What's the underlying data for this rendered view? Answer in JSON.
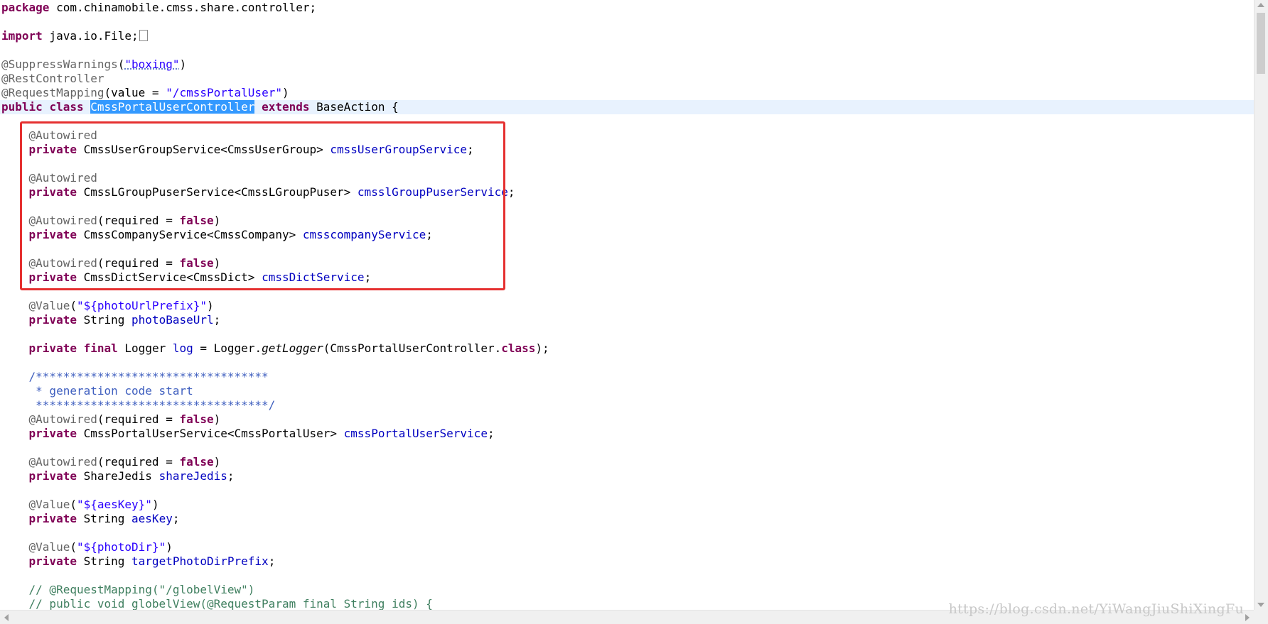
{
  "editor": {
    "lines": [
      [
        {
          "t": "package",
          "c": "kw"
        },
        {
          "t": " com.chinamobile.cmss.share.controller;"
        }
      ],
      [],
      [
        {
          "t": "import",
          "c": "kw"
        },
        {
          "t": " java.io.File;"
        },
        {
          "fold": true
        }
      ],
      [],
      [
        {
          "t": "@SuppressWarnings",
          "c": "ann"
        },
        {
          "t": "("
        },
        {
          "t": "\"boxing\"",
          "c": "str squig"
        },
        {
          "t": ")"
        }
      ],
      [
        {
          "t": "@RestController",
          "c": "ann"
        }
      ],
      [
        {
          "t": "@RequestMapping",
          "c": "ann"
        },
        {
          "t": "(value = "
        },
        {
          "t": "\"/cmssPortalUser\"",
          "c": "str"
        },
        {
          "t": ")"
        }
      ],
      [
        {
          "t": "public",
          "c": "kw"
        },
        {
          "t": " "
        },
        {
          "t": "class",
          "c": "kw"
        },
        {
          "t": " "
        },
        {
          "t": "CmssPortalUserController",
          "c": "sel"
        },
        {
          "t": " "
        },
        {
          "t": "extends",
          "c": "kw"
        },
        {
          "t": " BaseAction {"
        }
      ],
      [],
      [
        {
          "t": "    "
        },
        {
          "t": "@Autowired",
          "c": "ann"
        }
      ],
      [
        {
          "t": "    "
        },
        {
          "t": "private",
          "c": "kw"
        },
        {
          "t": " CmssUserGroupService<CmssUserGroup> "
        },
        {
          "t": "cmssUserGroupService",
          "c": "field"
        },
        {
          "t": ";"
        }
      ],
      [],
      [
        {
          "t": "    "
        },
        {
          "t": "@Autowired",
          "c": "ann"
        }
      ],
      [
        {
          "t": "    "
        },
        {
          "t": "private",
          "c": "kw"
        },
        {
          "t": " CmssLGroupPuserService<CmssLGroupPuser> "
        },
        {
          "t": "cmsslGroupPuserService",
          "c": "field"
        },
        {
          "t": ";"
        }
      ],
      [],
      [
        {
          "t": "    "
        },
        {
          "t": "@Autowired",
          "c": "ann"
        },
        {
          "t": "(required = "
        },
        {
          "t": "false",
          "c": "kw"
        },
        {
          "t": ")"
        }
      ],
      [
        {
          "t": "    "
        },
        {
          "t": "private",
          "c": "kw"
        },
        {
          "t": " CmssCompanyService<CmssCompany> "
        },
        {
          "t": "cmsscompanyService",
          "c": "field"
        },
        {
          "t": ";"
        }
      ],
      [],
      [
        {
          "t": "    "
        },
        {
          "t": "@Autowired",
          "c": "ann"
        },
        {
          "t": "(required = "
        },
        {
          "t": "false",
          "c": "kw"
        },
        {
          "t": ")"
        }
      ],
      [
        {
          "t": "    "
        },
        {
          "t": "private",
          "c": "kw"
        },
        {
          "t": " CmssDictService<CmssDict> "
        },
        {
          "t": "cmssDictService",
          "c": "field"
        },
        {
          "t": ";"
        }
      ],
      [],
      [
        {
          "t": "    "
        },
        {
          "t": "@Value",
          "c": "ann"
        },
        {
          "t": "("
        },
        {
          "t": "\"${photoUrlPrefix}\"",
          "c": "str"
        },
        {
          "t": ")"
        }
      ],
      [
        {
          "t": "    "
        },
        {
          "t": "private",
          "c": "kw"
        },
        {
          "t": " String "
        },
        {
          "t": "photoBaseUrl",
          "c": "field"
        },
        {
          "t": ";"
        }
      ],
      [],
      [
        {
          "t": "    "
        },
        {
          "t": "private",
          "c": "kw"
        },
        {
          "t": " "
        },
        {
          "t": "final",
          "c": "kw"
        },
        {
          "t": " Logger "
        },
        {
          "t": "log",
          "c": "field"
        },
        {
          "t": " = Logger."
        },
        {
          "t": "getLogger",
          "c": "ital"
        },
        {
          "t": "(CmssPortalUserController."
        },
        {
          "t": "class",
          "c": "kw"
        },
        {
          "t": ");"
        }
      ],
      [],
      [
        {
          "t": "    "
        },
        {
          "t": "/**********************************",
          "c": "cmt"
        }
      ],
      [
        {
          "t": "     * generation code start",
          "c": "cmt"
        }
      ],
      [
        {
          "t": "     **********************************/",
          "c": "cmt"
        }
      ],
      [
        {
          "t": "    "
        },
        {
          "t": "@Autowired",
          "c": "ann"
        },
        {
          "t": "(required = "
        },
        {
          "t": "false",
          "c": "kw"
        },
        {
          "t": ")"
        }
      ],
      [
        {
          "t": "    "
        },
        {
          "t": "private",
          "c": "kw"
        },
        {
          "t": " CmssPortalUserService<CmssPortalUser> "
        },
        {
          "t": "cmssPortalUserService",
          "c": "field"
        },
        {
          "t": ";"
        }
      ],
      [],
      [
        {
          "t": "    "
        },
        {
          "t": "@Autowired",
          "c": "ann"
        },
        {
          "t": "(required = "
        },
        {
          "t": "false",
          "c": "kw"
        },
        {
          "t": ")"
        }
      ],
      [
        {
          "t": "    "
        },
        {
          "t": "private",
          "c": "kw"
        },
        {
          "t": " ShareJedis "
        },
        {
          "t": "shareJedis",
          "c": "field"
        },
        {
          "t": ";"
        }
      ],
      [],
      [
        {
          "t": "    "
        },
        {
          "t": "@Value",
          "c": "ann"
        },
        {
          "t": "("
        },
        {
          "t": "\"${aesKey}\"",
          "c": "str"
        },
        {
          "t": ")"
        }
      ],
      [
        {
          "t": "    "
        },
        {
          "t": "private",
          "c": "kw"
        },
        {
          "t": " String "
        },
        {
          "t": "aesKey",
          "c": "field"
        },
        {
          "t": ";"
        }
      ],
      [],
      [
        {
          "t": "    "
        },
        {
          "t": "@Value",
          "c": "ann"
        },
        {
          "t": "("
        },
        {
          "t": "\"${photoDir}\"",
          "c": "str"
        },
        {
          "t": ")"
        }
      ],
      [
        {
          "t": "    "
        },
        {
          "t": "private",
          "c": "kw"
        },
        {
          "t": " String "
        },
        {
          "t": "targetPhotoDirPrefix",
          "c": "field"
        },
        {
          "t": ";"
        }
      ],
      [],
      [
        {
          "t": "    // @RequestMapping(\"/globelView\")",
          "c": "lcmt"
        }
      ],
      [
        {
          "t": "    // public void globelView(@RequestParam final String ids) {",
          "c": "lcmt"
        }
      ]
    ],
    "current_line": 7
  },
  "watermark": "https://blog.csdn.net/YiWangJiuShiXingFu",
  "colors": {
    "keyword": "#7f0055",
    "annotation": "#646464",
    "string": "#2a00ff",
    "field": "#0000c0",
    "comment": "#3f5fbf",
    "line_comment": "#3f7f5f",
    "selection": "#3399ff",
    "highlight_box": "#e53030"
  }
}
